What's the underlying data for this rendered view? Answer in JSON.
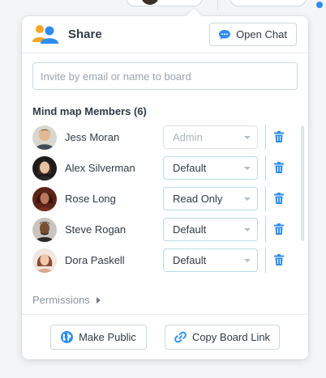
{
  "header": {
    "title": "Share",
    "open_chat_label": "Open Chat",
    "icons": {
      "share": "users-icon",
      "chat": "chat-bubble-icon"
    }
  },
  "invite": {
    "placeholder": "Invite by email or name to board"
  },
  "members": {
    "title": "Mind map Members (6)",
    "rows": [
      {
        "name": "Jess Moran",
        "role": "Admin",
        "role_disabled": true
      },
      {
        "name": "Alex Silverman",
        "role": "Default",
        "role_disabled": false
      },
      {
        "name": "Rose Long",
        "role": "Read Only",
        "role_disabled": false
      },
      {
        "name": "Steve Rogan",
        "role": "Default",
        "role_disabled": false
      },
      {
        "name": "Dora Paskell",
        "role": "Default",
        "role_disabled": false
      }
    ]
  },
  "permissions_label": "Permissions",
  "footer": {
    "make_public_label": "Make Public",
    "copy_link_label": "Copy Board Link"
  },
  "colors": {
    "accent": "#2d8cf0",
    "share_icon_primary": "#2d8cf0",
    "share_icon_secondary": "#f5a623"
  }
}
